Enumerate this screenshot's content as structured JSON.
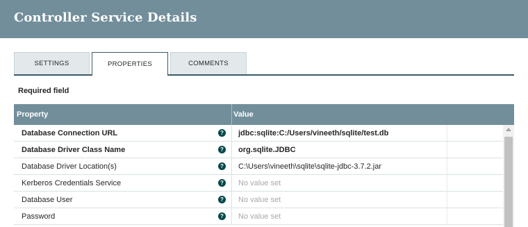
{
  "header": {
    "title": "Controller Service Details"
  },
  "tabs": [
    {
      "label": "SETTINGS"
    },
    {
      "label": "PROPERTIES"
    },
    {
      "label": "COMMENTS"
    }
  ],
  "required_field_label": "Required field",
  "table": {
    "columns": {
      "property": "Property",
      "value": "Value"
    },
    "rows": [
      {
        "property": "Database Connection URL",
        "value": "jdbc:sqlite:C:/Users/vineeth/sqlite/test.db",
        "required": true
      },
      {
        "property": "Database Driver Class Name",
        "value": "org.sqlite.JDBC",
        "required": true
      },
      {
        "property": "Database Driver Location(s)",
        "value": "C:\\Users\\vineeth\\sqlite\\sqlite-jdbc-3.7.2.jar",
        "required": false
      },
      {
        "property": "Kerberos Credentials Service",
        "value": "No value set",
        "required": false
      },
      {
        "property": "Database User",
        "value": "No value set",
        "required": false
      },
      {
        "property": "Password",
        "value": "No value set",
        "required": false
      }
    ],
    "help_icon": "?"
  },
  "colors": {
    "header_bg": "#728e9b",
    "tab_active_border": "#3a5a66",
    "help_icon_bg": "#004849"
  }
}
